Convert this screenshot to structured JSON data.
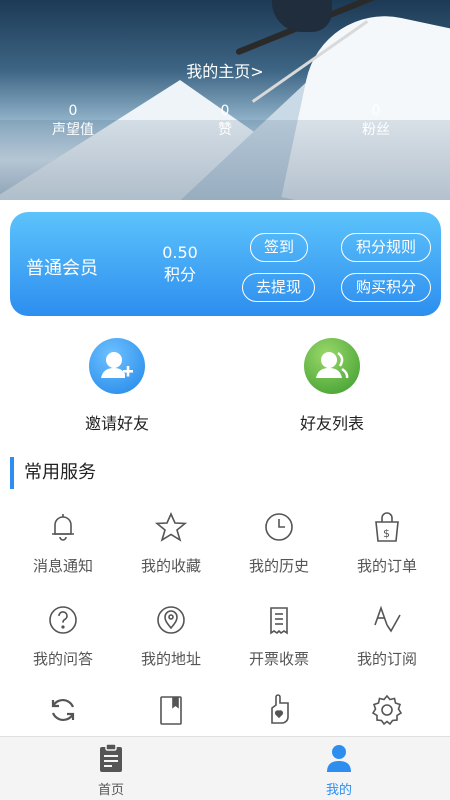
{
  "hero": {
    "title": "我的主页>",
    "stats": [
      {
        "value": "0",
        "label": "声望值"
      },
      {
        "value": "0",
        "label": "赞"
      },
      {
        "value": "0",
        "label": "粉丝"
      }
    ]
  },
  "membership": {
    "level": "普通会员",
    "points_value": "0.50",
    "points_label": "积分",
    "buttons": {
      "checkin": "签到",
      "rules": "积分规则",
      "withdraw": "去提现",
      "buy": "购买积分"
    }
  },
  "friends": {
    "invite": {
      "label": "邀请好友",
      "icon": "add-user-icon"
    },
    "list": {
      "label": "好友列表",
      "icon": "users-icon"
    }
  },
  "services": {
    "title": "常用服务",
    "items": [
      {
        "label": "消息通知",
        "icon": "bell-icon"
      },
      {
        "label": "我的收藏",
        "icon": "star-icon"
      },
      {
        "label": "我的历史",
        "icon": "clock-icon"
      },
      {
        "label": "我的订单",
        "icon": "shopping-bag-icon"
      },
      {
        "label": "我的问答",
        "icon": "question-icon"
      },
      {
        "label": "我的地址",
        "icon": "location-pin-icon"
      },
      {
        "label": "开票收票",
        "icon": "receipt-icon"
      },
      {
        "label": "我的订阅",
        "icon": "subscribe-icon"
      },
      {
        "label": "",
        "icon": "refresh-icon"
      },
      {
        "label": "",
        "icon": "bookmark-icon"
      },
      {
        "label": "",
        "icon": "heart-hand-icon"
      },
      {
        "label": "",
        "icon": "gear-icon"
      }
    ]
  },
  "tabbar": {
    "home": "首页",
    "mine": "我的"
  },
  "colors": {
    "accent": "#2d8eef",
    "card_top": "#5cc3fb",
    "tab_active": "#2d8eef",
    "tab_inactive": "#555555"
  }
}
